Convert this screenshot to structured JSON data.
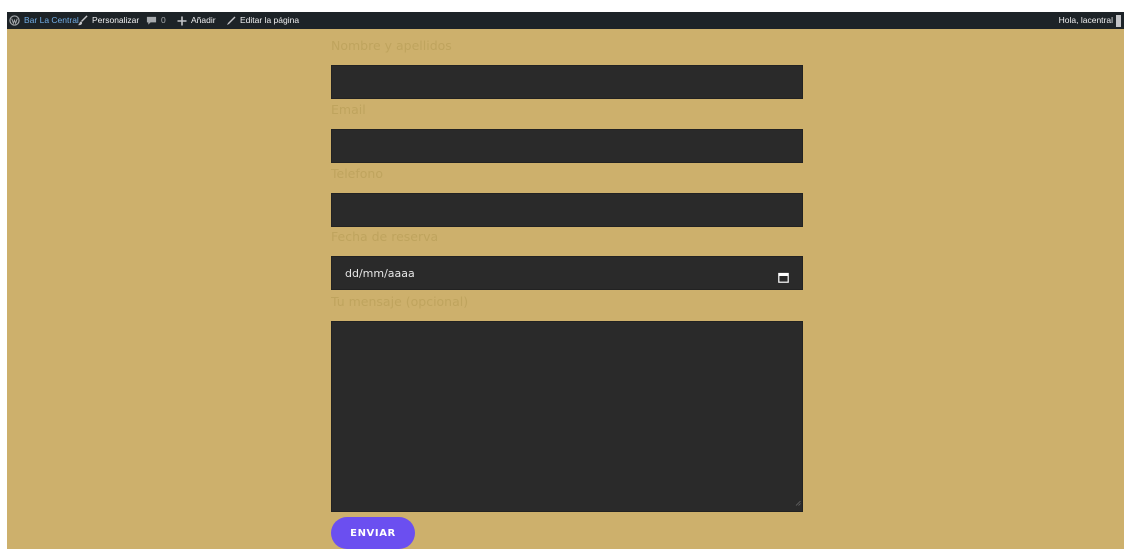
{
  "admin_bar": {
    "site_name": "Bar La Central",
    "customize": "Personalizar",
    "comments_count": "0",
    "add_new": "Añadir",
    "edit_page": "Editar la página",
    "greeting": "Hola, lacentral"
  },
  "form": {
    "name_label": "Nombre y apellidos",
    "name_value": "",
    "email_label": "Email",
    "email_value": "",
    "phone_label": "Telefono",
    "phone_value": "",
    "date_label": "Fecha de reserva",
    "date_value": "dd/mm/aaaa",
    "message_label": "Tu mensaje (opcional)",
    "message_value": "",
    "submit_label": "ENVIAR"
  },
  "colors": {
    "page_background": "#cdb06c",
    "field_background": "#2a2a2a",
    "label_color": "#bfa45e",
    "button_color": "#6b4ff0",
    "admin_bar": "#1d2327"
  },
  "icons": [
    "wordpress-icon",
    "brush-icon",
    "comment-icon",
    "plus-icon",
    "pencil-icon",
    "calendar-icon",
    "resize-handle-icon"
  ]
}
